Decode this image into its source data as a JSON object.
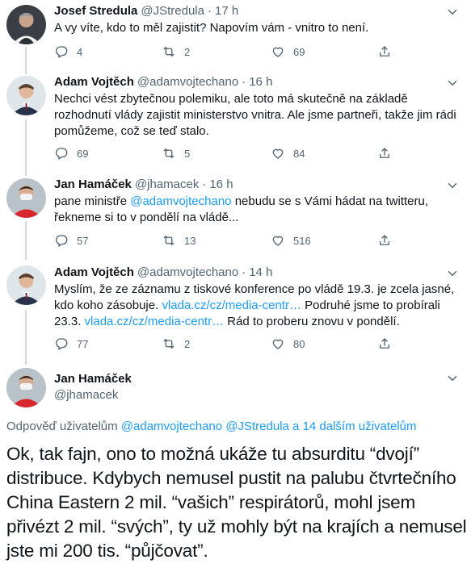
{
  "tweets": [
    {
      "name": "Josef Stredula",
      "handle": "@JStredula",
      "time": "17 h",
      "text_parts": [
        {
          "t": "A vy víte, kdo to měl zajistit? Napovím vám - vnitro to není.",
          "link": false
        }
      ],
      "replies": "4",
      "retweets": "2",
      "likes": "69"
    },
    {
      "name": "Adam Vojtěch",
      "handle": "@adamvojtechano",
      "time": "16 h",
      "text_parts": [
        {
          "t": "Nechci vést zbytečnou polemiku, ale toto má skutečně na základě rozhodnutí vlády zajistit ministerstvo vnitra. Ale jsme partneři, takže jim rádi pomůžeme, což se teď stalo.",
          "link": false
        }
      ],
      "replies": "69",
      "retweets": "5",
      "likes": "84"
    },
    {
      "name": "Jan Hamáček",
      "handle": "@jhamacek",
      "time": "16 h",
      "text_parts": [
        {
          "t": "pane ministře ",
          "link": false
        },
        {
          "t": "@adamvojtechano",
          "link": true
        },
        {
          "t": " nebudu se s Vámi hádat na twitteru, řekneme si to v pondělí na vládě...",
          "link": false
        }
      ],
      "replies": "57",
      "retweets": "13",
      "likes": "516"
    },
    {
      "name": "Adam Vojtěch",
      "handle": "@adamvojtechano",
      "time": "14 h",
      "text_parts": [
        {
          "t": "Myslím, že ze záznamu z tiskové konference po vládě 19.3. je zcela jasné, kdo koho zásobuje. ",
          "link": false
        },
        {
          "t": "vlada.cz/cz/media-centr…",
          "link": true
        },
        {
          "t": " Podruhé jsme to probírali 23.3. ",
          "link": false
        },
        {
          "t": "vlada.cz/cz/media-centr…",
          "link": true
        },
        {
          "t": " Rád to proberu znovu v pondělí.",
          "link": false
        }
      ],
      "replies": "77",
      "retweets": "2",
      "likes": "80"
    }
  ],
  "focus": {
    "name": "Jan Hamáček",
    "handle": "@jhamacek",
    "replying_prefix": "Odpověď uživatelům ",
    "replying_user1": "@adamvojtechano",
    "replying_user2": "@JStredula",
    "replying_suffix": " a 14 dalším uživatelům",
    "text": "Ok, tak fajn, ono to možná ukáže tu absurditu “dvojí” distribuce. Kdybych nemusel pustit na palubu čtvrtečního China Eastern 2 mil. “vašich” respirátorů, mohl jsem přivézt 2 mil. “svých”, ty už mohly být na krajích a nemusel jste mi 200 tis. “půjčovat”."
  },
  "colors": {
    "link": "#1d9bf0",
    "secondary": "#536471",
    "text": "#0f1419",
    "thread_line": "#cfd9de"
  },
  "icons": [
    "reply-icon",
    "retweet-icon",
    "like-icon",
    "share-icon",
    "more-icon"
  ]
}
